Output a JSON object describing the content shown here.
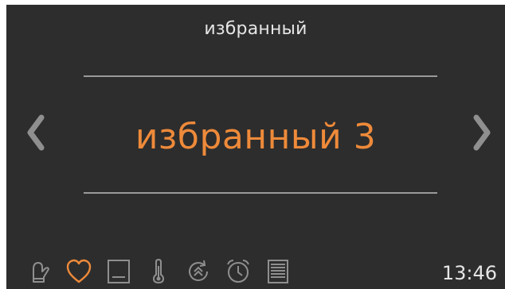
{
  "screen": {
    "title": "избранный",
    "selected_value": "избранный 3",
    "clock": "13:46"
  },
  "colors": {
    "background": "#2d2d2d",
    "accent": "#ee8a3a",
    "text": "#e6e6e6",
    "icon": "#8f8f8f",
    "divider": "#9a9a9a"
  },
  "icons": {
    "prev": "chevron-left-icon",
    "next": "chevron-right-icon",
    "bottom_bar": [
      "oven-mitt-icon",
      "heart-icon",
      "panel-icon",
      "thermometer-icon",
      "boost-icon",
      "alarm-clock-icon",
      "settings-list-icon"
    ],
    "active": "heart-icon"
  }
}
